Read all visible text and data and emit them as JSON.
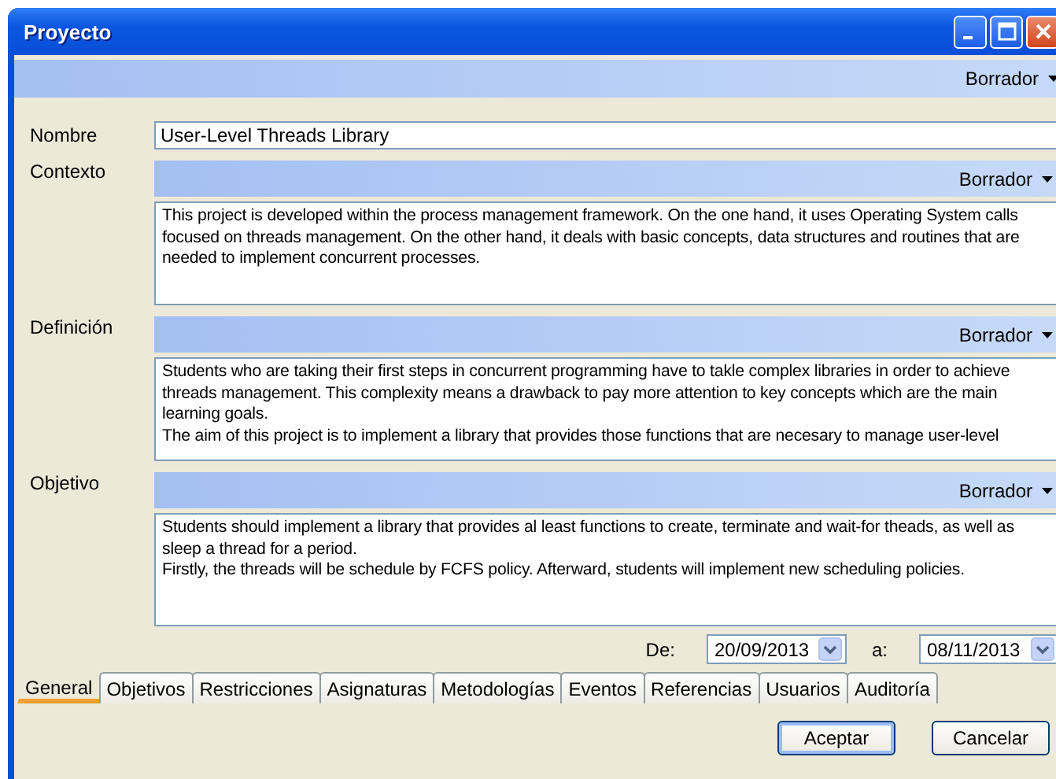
{
  "window": {
    "title": "Proyecto"
  },
  "top_status": {
    "label": "Borrador"
  },
  "name_field": {
    "label": "Nombre",
    "value": "User-Level Threads Library"
  },
  "sections": [
    {
      "label": "Contexto",
      "status": "Borrador",
      "text": "This project is developed within the process management framework. On the one hand, it uses Operating System calls focused on threads management. On the other hand, it deals with basic concepts, data structures and routines that are needed to implement concurrent processes."
    },
    {
      "label": "Definición",
      "status": "Borrador",
      "text": "Students who are taking their first steps in concurrent programming have to takle complex libraries in order to achieve threads management. This complexity means a drawback to pay more attention to key concepts which are the main learning goals.\nThe aim of this project is to implement a library that provides those functions that are necesary to manage user-level"
    },
    {
      "label": "Objetivo",
      "status": "Borrador",
      "text": "Students should implement a library that provides al least functions to create, terminate and wait-for theads, as well as sleep a thread for a period.\nFirstly, the threads will be schedule by FCFS policy. Afterward, students will implement new scheduling policies."
    }
  ],
  "dates": [
    {
      "label": "De:",
      "value": "20/09/2013"
    },
    {
      "label": "a:",
      "value": "08/11/2013"
    }
  ],
  "tabs": [
    {
      "label": "General",
      "selected": true
    },
    {
      "label": "Objetivos",
      "selected": false
    },
    {
      "label": "Restricciones",
      "selected": false
    },
    {
      "label": "Asignaturas",
      "selected": false
    },
    {
      "label": "Metodologías",
      "selected": false
    },
    {
      "label": "Eventos",
      "selected": false
    },
    {
      "label": "Referencias",
      "selected": false
    },
    {
      "label": "Usuarios",
      "selected": false
    },
    {
      "label": "Auditoría",
      "selected": false
    }
  ],
  "buttons": [
    {
      "label": "Aceptar",
      "kind": "default"
    },
    {
      "label": "Cancelar",
      "kind": "normal"
    }
  ]
}
